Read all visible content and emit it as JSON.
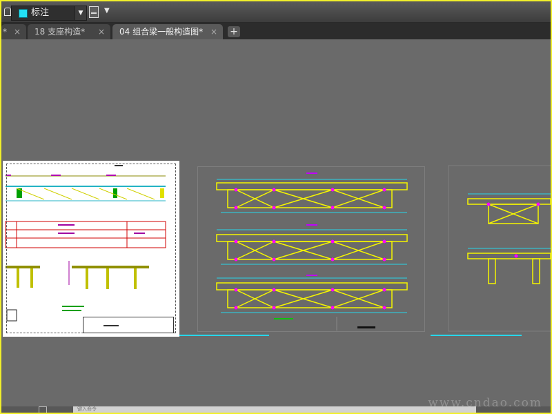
{
  "toolbar": {
    "layer_name": "标注",
    "layer_color": "#23e1f5"
  },
  "tabs": [
    {
      "label": "*",
      "active": false
    },
    {
      "label": "18 支座构造*",
      "active": false
    },
    {
      "label": "04 组合梁一般构造图*",
      "active": true
    }
  ],
  "new_tab_label": "+",
  "close_glyph": "×",
  "command_line": {
    "prompt": "键入命令"
  },
  "watermark": "www.cndao.com",
  "colors": {
    "accent_yellow": "#f1ef2a",
    "cad_cyan": "#27d6ea",
    "cad_yellow": "#f5f500",
    "cad_magenta": "#ff00ff"
  }
}
